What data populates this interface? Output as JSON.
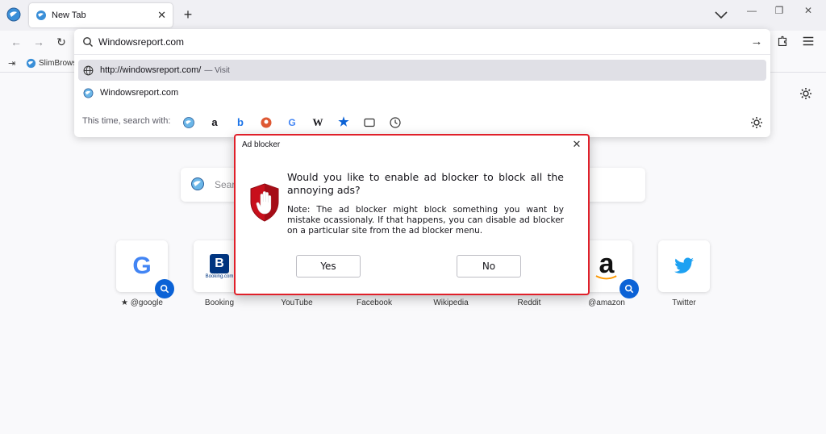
{
  "colors": {
    "accent_blue": "#0b62d6",
    "dialog_border": "#e0202a"
  },
  "tab": {
    "label": "New Tab"
  },
  "address": {
    "value": "Windowsreport.com"
  },
  "suggestions": [
    {
      "text": "http://windowsreport.com/",
      "suffix": "— Visit",
      "icon": "globe-icon"
    },
    {
      "text": "Windowsreport.com",
      "suffix": "",
      "icon": "slimbrowser-icon"
    }
  ],
  "search_with_label": "This time, search with:",
  "search_engines": [
    "slimbrowser",
    "amazon",
    "bing",
    "duckduckgo",
    "google",
    "wikipedia",
    "bookmarks",
    "tabs",
    "history"
  ],
  "bookmarks": {
    "items": [
      {
        "label": "SlimBrows"
      }
    ]
  },
  "newtab": {
    "search_placeholder": "Sear"
  },
  "top_sites": [
    {
      "name": "@google",
      "prefix": "★ ",
      "logo": "G",
      "badge": true
    },
    {
      "name": "Booking",
      "logo": "B",
      "badge": false,
      "sub": "Booking.com"
    },
    {
      "name": "YouTube",
      "logo": "",
      "badge": false
    },
    {
      "name": "Facebook",
      "logo": "",
      "badge": false
    },
    {
      "name": "Wikipedia",
      "logo": "",
      "badge": false
    },
    {
      "name": "Reddit",
      "logo": "",
      "badge": false
    },
    {
      "name": "@amazon",
      "logo": "a",
      "badge": true
    },
    {
      "name": "Twitter",
      "logo": "",
      "badge": false
    }
  ],
  "dialog": {
    "title": "Ad blocker",
    "question": "Would you like to enable ad blocker to block all the annoying ads?",
    "note": "Note: The ad blocker might block something you want by mistake ocassionaly. If that happens, you can disable ad blocker on a particular site from the ad blocker menu.",
    "yes": "Yes",
    "no": "No"
  }
}
